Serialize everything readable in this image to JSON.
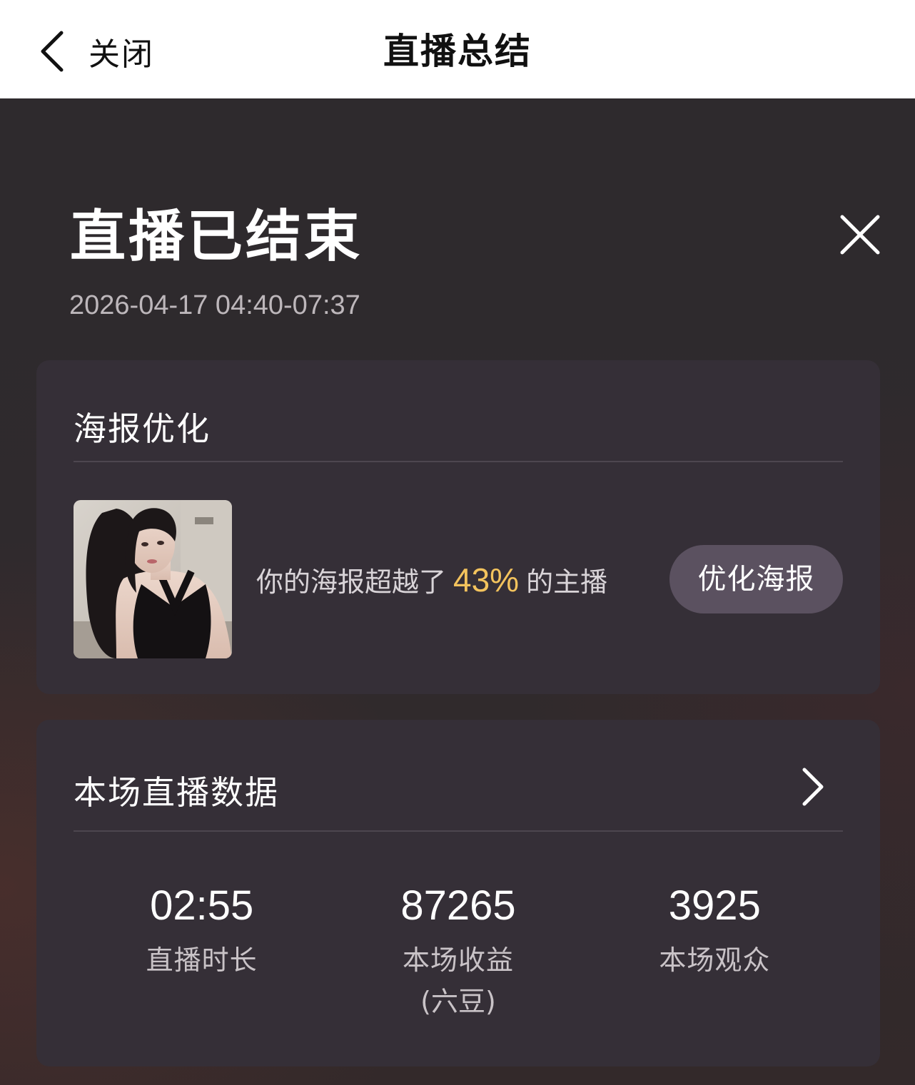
{
  "nav": {
    "back_label": "关闭",
    "title": "直播总结"
  },
  "summary": {
    "headline": "直播已结束",
    "datetime": "2026-04-17 04:40-07:37"
  },
  "poster_card": {
    "title": "海报优化",
    "text_before": "你的海报超越了",
    "percent": "43%",
    "text_after": "的主播",
    "button_label": "优化海报"
  },
  "data_card": {
    "title": "本场直播数据",
    "stats": [
      {
        "value": "02:55",
        "label": "直播时长",
        "sub": ""
      },
      {
        "value": "87265",
        "label": "本场收益",
        "sub": "(六豆)"
      },
      {
        "value": "3925",
        "label": "本场观众",
        "sub": ""
      }
    ]
  },
  "colors": {
    "accent_percent": "#f3c35d",
    "card_bg": "#352f37",
    "button_bg": "#5b5160"
  },
  "icons": [
    "chevron-left-icon",
    "close-icon",
    "chevron-right-icon"
  ]
}
